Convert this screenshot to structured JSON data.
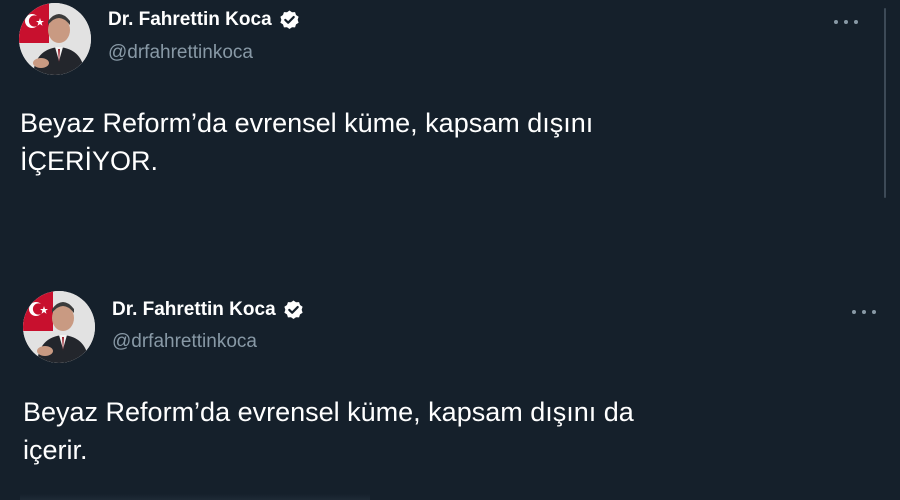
{
  "colors": {
    "background": "#15202b",
    "text_primary": "#ffffff",
    "text_secondary": "#8899a6",
    "verified_badge": "#ffffff"
  },
  "tweets": [
    {
      "author": {
        "name": "Dr. Fahrettin Koca",
        "handle": "@drfahrettinkoca",
        "verified_icon": "verified-badge-icon",
        "avatar_icon": "profile-photo-avatar"
      },
      "text": "Beyaz Reform’da evrensel küme, kapsam dışını\nİÇERİYOR.",
      "more_icon": "more-options-icon"
    },
    {
      "author": {
        "name": "Dr. Fahrettin Koca",
        "handle": "@drfahrettinkoca",
        "verified_icon": "verified-badge-icon",
        "avatar_icon": "profile-photo-avatar"
      },
      "text": "Beyaz Reform’da evrensel küme, kapsam dışını da\niçerir.",
      "more_icon": "more-options-icon"
    }
  ]
}
